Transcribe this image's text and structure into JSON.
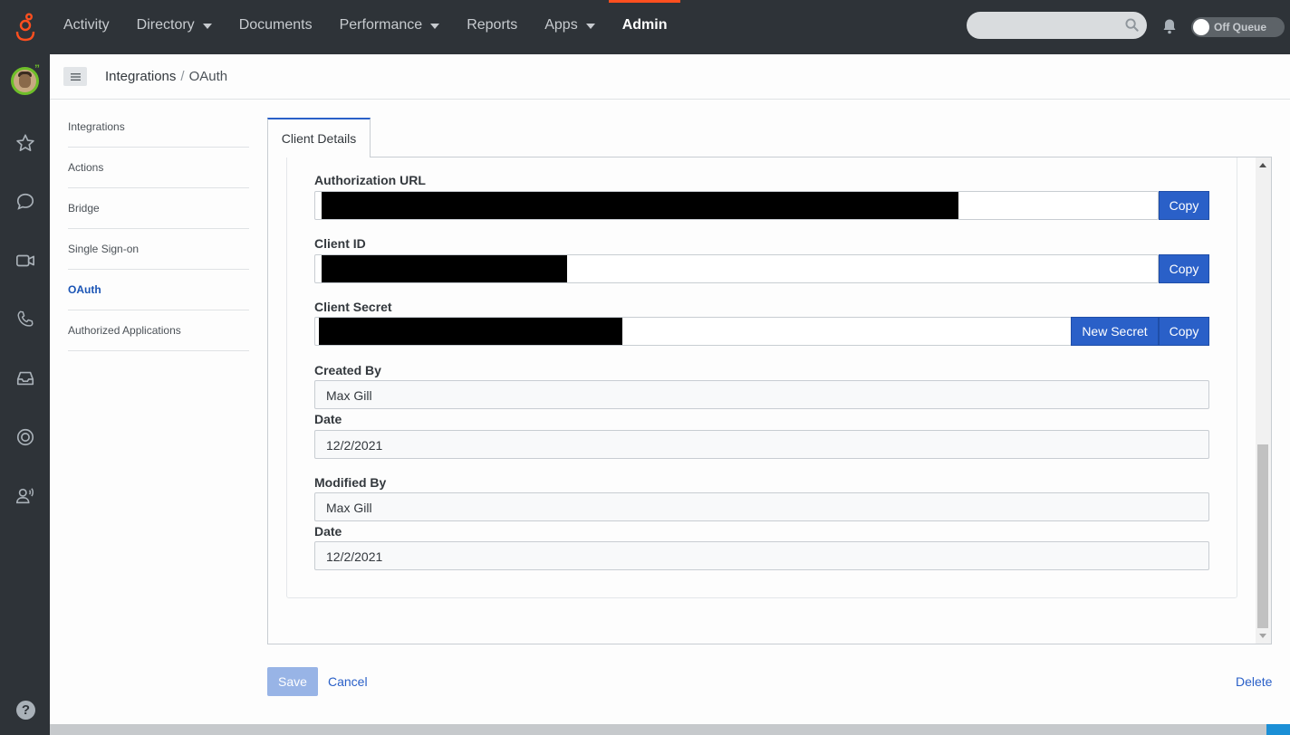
{
  "topnav": {
    "items": [
      {
        "label": "Activity",
        "dropdown": false
      },
      {
        "label": "Directory",
        "dropdown": true
      },
      {
        "label": "Documents",
        "dropdown": false
      },
      {
        "label": "Performance",
        "dropdown": true
      },
      {
        "label": "Reports",
        "dropdown": false
      },
      {
        "label": "Apps",
        "dropdown": true
      },
      {
        "label": "Admin",
        "dropdown": false,
        "active": true
      }
    ],
    "queue_label": "Off Queue",
    "accent_color": "#ff4f1f"
  },
  "breadcrumb": {
    "parent": "Integrations",
    "separator": "/",
    "current": "OAuth"
  },
  "subnav": {
    "items": [
      {
        "label": "Integrations"
      },
      {
        "label": "Actions"
      },
      {
        "label": "Bridge"
      },
      {
        "label": "Single Sign-on"
      },
      {
        "label": "OAuth",
        "active": true
      },
      {
        "label": "Authorized Applications"
      }
    ]
  },
  "tab": {
    "label": "Client Details"
  },
  "form": {
    "authorization_url": {
      "label": "Authorization URL",
      "copy_label": "Copy"
    },
    "client_id": {
      "label": "Client ID",
      "copy_label": "Copy"
    },
    "client_secret": {
      "label": "Client Secret",
      "new_secret_label": "New Secret",
      "copy_label": "Copy"
    },
    "created_by": {
      "label": "Created By",
      "value": "Max Gill"
    },
    "created_date": {
      "label": "Date",
      "value": "12/2/2021"
    },
    "modified_by": {
      "label": "Modified By",
      "value": "Max Gill"
    },
    "modified_date": {
      "label": "Date",
      "value": "12/2/2021"
    }
  },
  "footer": {
    "save_label": "Save",
    "cancel_label": "Cancel",
    "delete_label": "Delete"
  },
  "colors": {
    "primary_button": "#2a60c8",
    "sidebar_bg": "#2e3338",
    "active_link": "#1a54b5"
  },
  "icons": [
    "genesys-logo",
    "avatar",
    "star-icon",
    "chat-icon",
    "video-icon",
    "phone-icon",
    "inbox-icon",
    "target-icon",
    "user-voice-icon",
    "help-icon",
    "search-icon",
    "bell-icon",
    "hamburger-icon"
  ]
}
